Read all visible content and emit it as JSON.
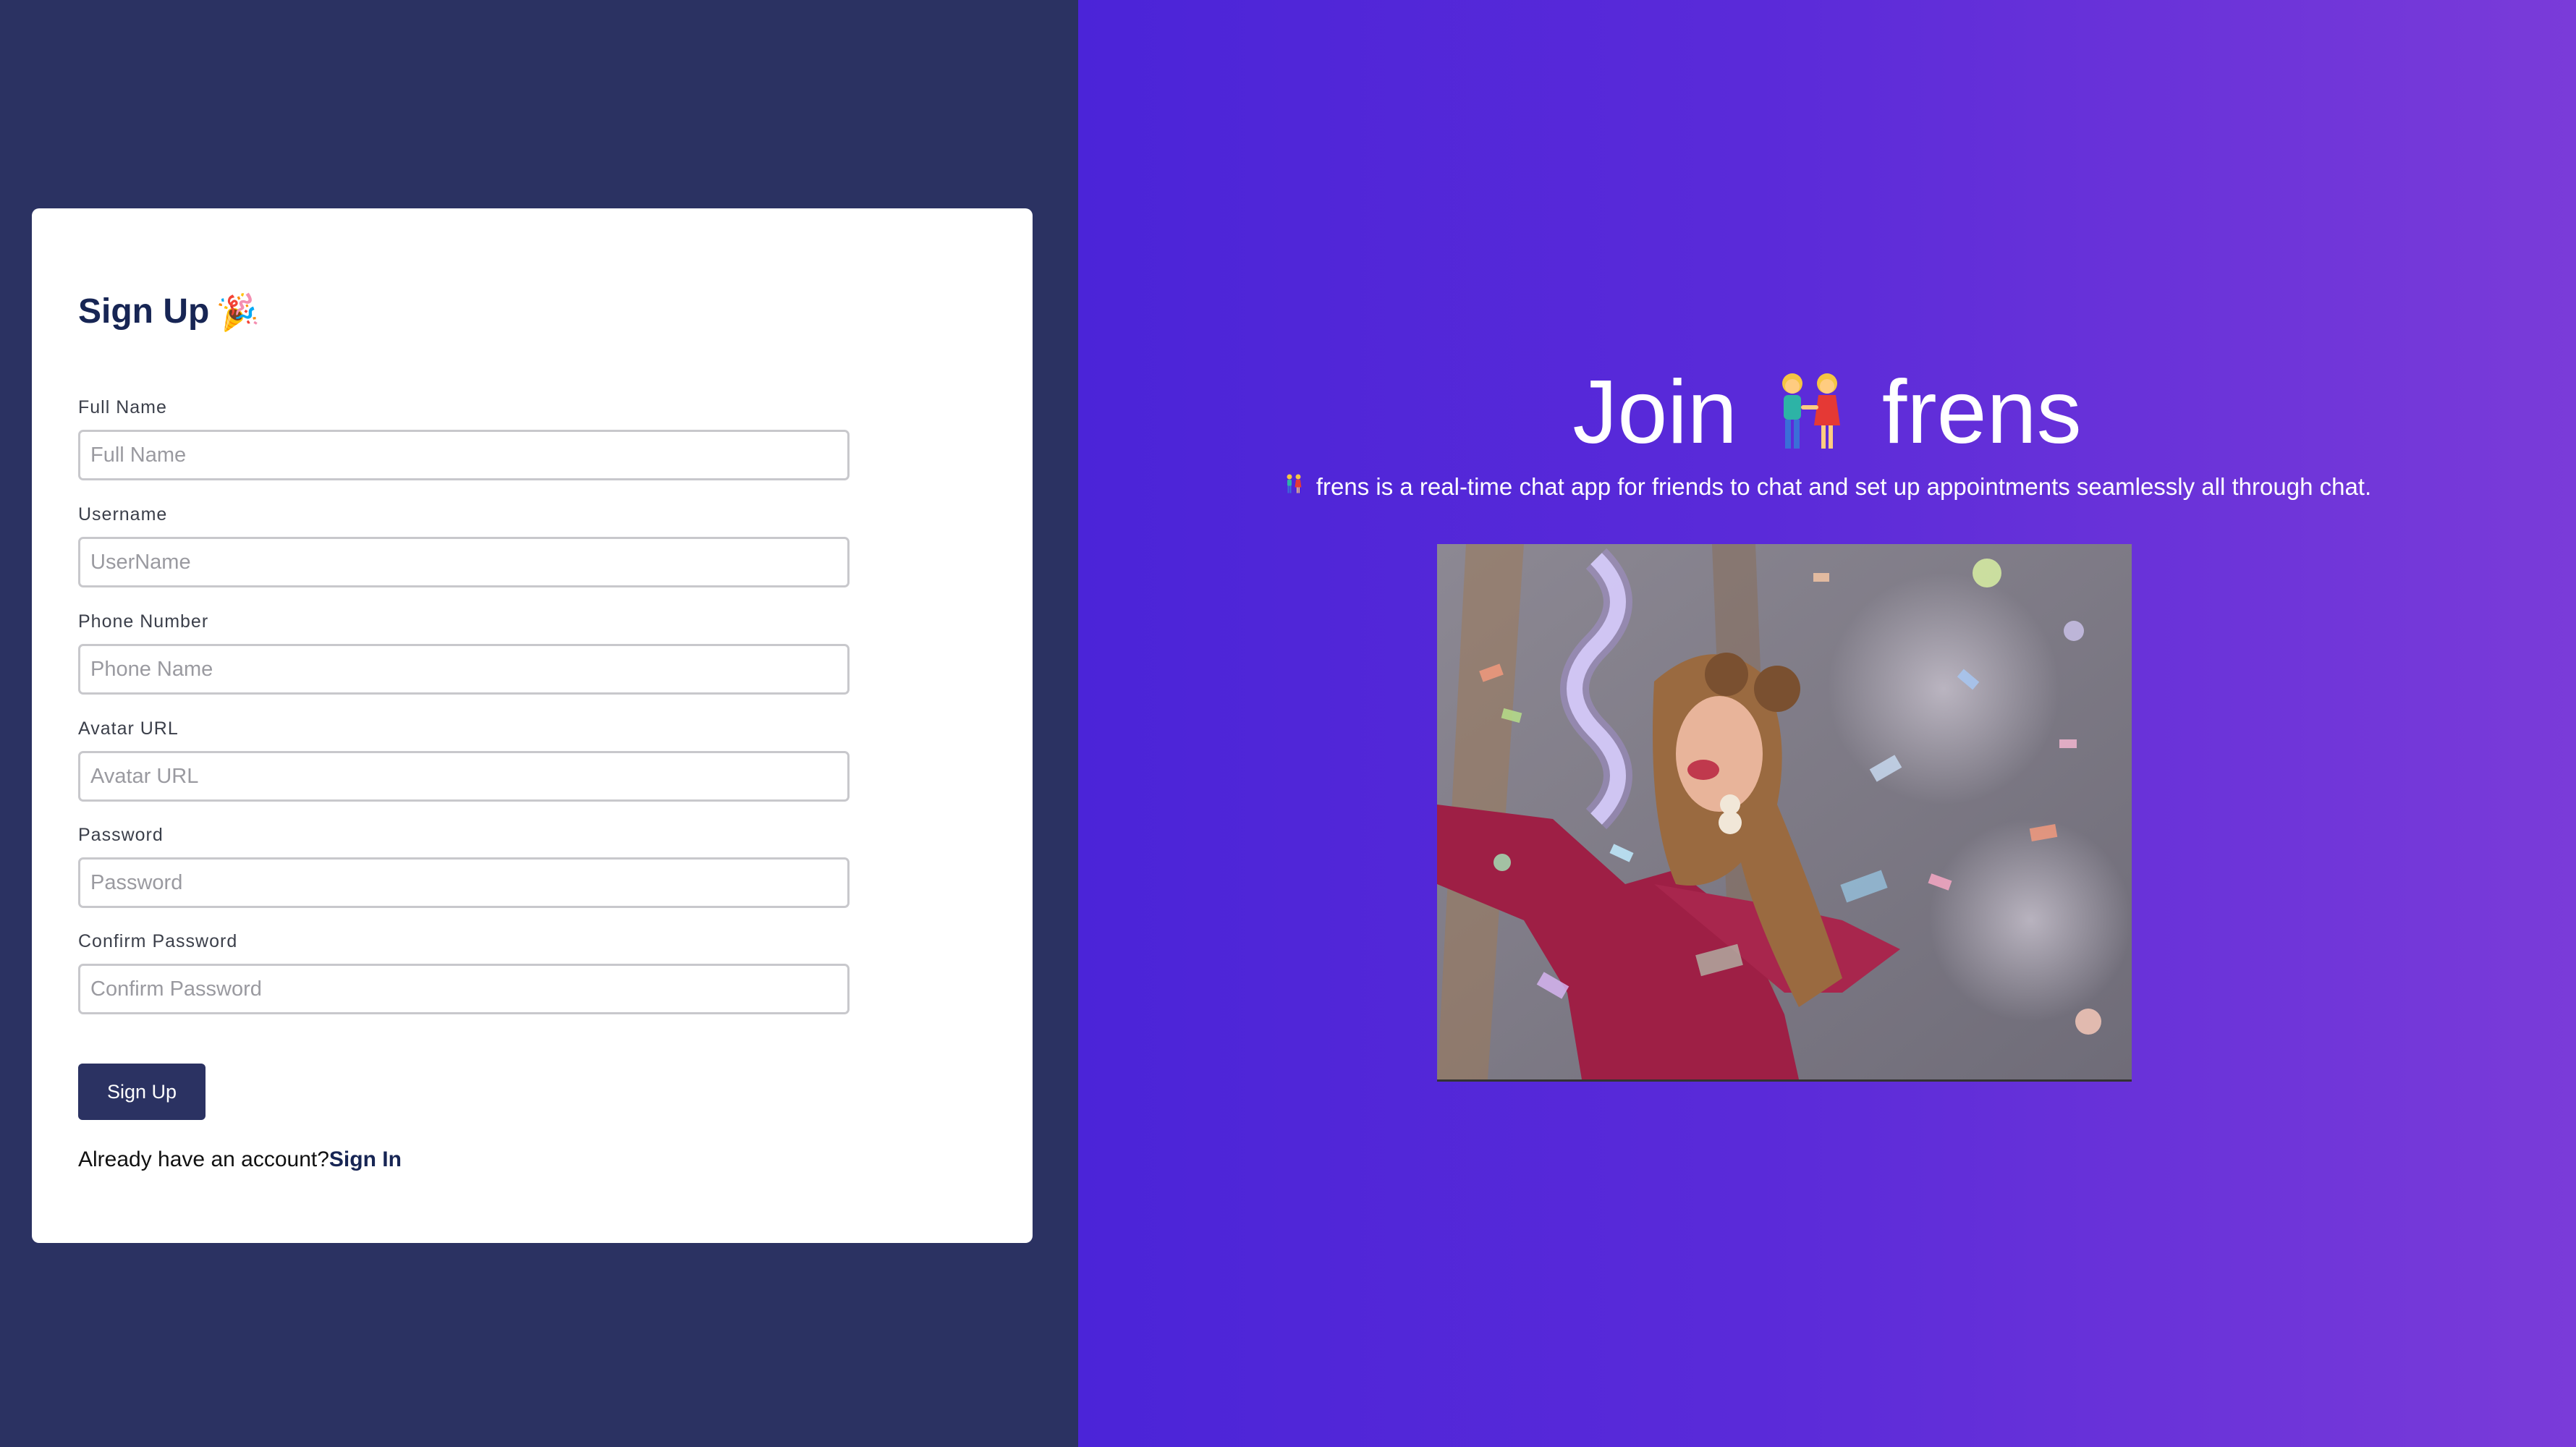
{
  "signup": {
    "title": "Sign Up",
    "title_icon": "party-popper-icon",
    "fields": [
      {
        "label": "Full Name",
        "placeholder": "Full Name"
      },
      {
        "label": "Username",
        "placeholder": "UserName"
      },
      {
        "label": "Phone Number",
        "placeholder": "Phone Name"
      },
      {
        "label": "Avatar URL",
        "placeholder": "Avatar URL"
      },
      {
        "label": "Password",
        "placeholder": "Password"
      },
      {
        "label": "Confirm Password",
        "placeholder": "Confirm Password"
      }
    ],
    "submit_label": "Sign Up",
    "signin_prompt": "Already have an account?",
    "signin_link": "Sign In"
  },
  "hero": {
    "title_before": "Join",
    "title_icon": "two-women-holding-hands-icon",
    "title_after": "frens",
    "subtitle_icon": "two-women-holding-hands-icon",
    "subtitle": "frens is a real-time chat app for friends to chat and set up appointments seamlessly all through chat.",
    "image": "celebration-confetti-gif"
  },
  "colors": {
    "left_background": "#2b3262",
    "right_gradient_start": "#4b24d8",
    "right_gradient_end": "#7a3bd9",
    "title_color": "#172554",
    "button_background": "#2b3262"
  }
}
